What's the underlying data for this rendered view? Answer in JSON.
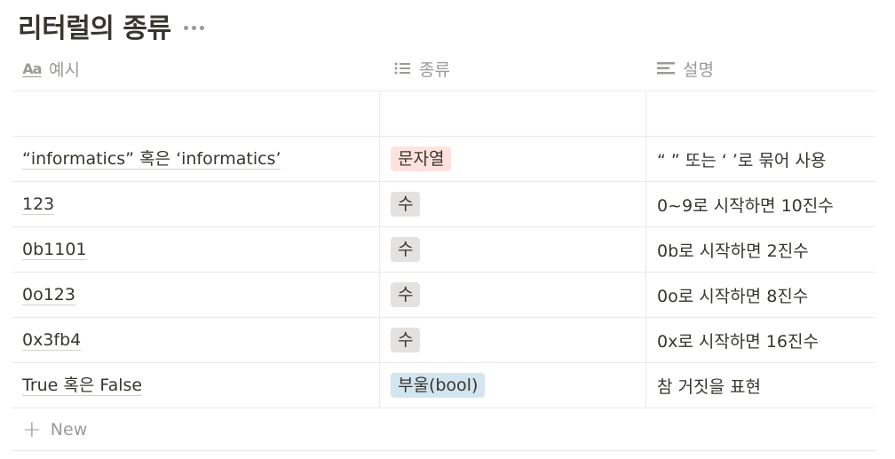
{
  "page": {
    "title": "리터럴의 종류"
  },
  "table": {
    "columns": [
      {
        "label": "예시",
        "icon": "title-property-icon"
      },
      {
        "label": "종류",
        "icon": "list-icon"
      },
      {
        "label": "설명",
        "icon": "text-lines-icon"
      }
    ],
    "rows": [
      {
        "example": "",
        "type": "",
        "type_color": "",
        "desc": ""
      },
      {
        "example": "“informatics” 혹은 ‘informatics’",
        "type": "문자열",
        "type_color": "#ffe2dd",
        "desc": "“ ” 또는 ‘ ’로 묶어 사용"
      },
      {
        "example": "123",
        "type": "수",
        "type_color": "#e3e2e0",
        "desc": "0~9로 시작하면 10진수"
      },
      {
        "example": "0b1101",
        "type": "수",
        "type_color": "#e3e2e0",
        "desc": "0b로 시작하면 2진수"
      },
      {
        "example": "0o123",
        "type": "수",
        "type_color": "#e3e2e0",
        "desc": "0o로 시작하면 8진수"
      },
      {
        "example": "0x3fb4",
        "type": "수",
        "type_color": "#e3e2e0",
        "desc": "0x로 시작하면 16진수"
      },
      {
        "example": "True 혹은 False",
        "type": "부울(bool)",
        "type_color": "#d3e5ef",
        "desc": "참 거짓을 표현"
      }
    ],
    "new_label": "New"
  }
}
